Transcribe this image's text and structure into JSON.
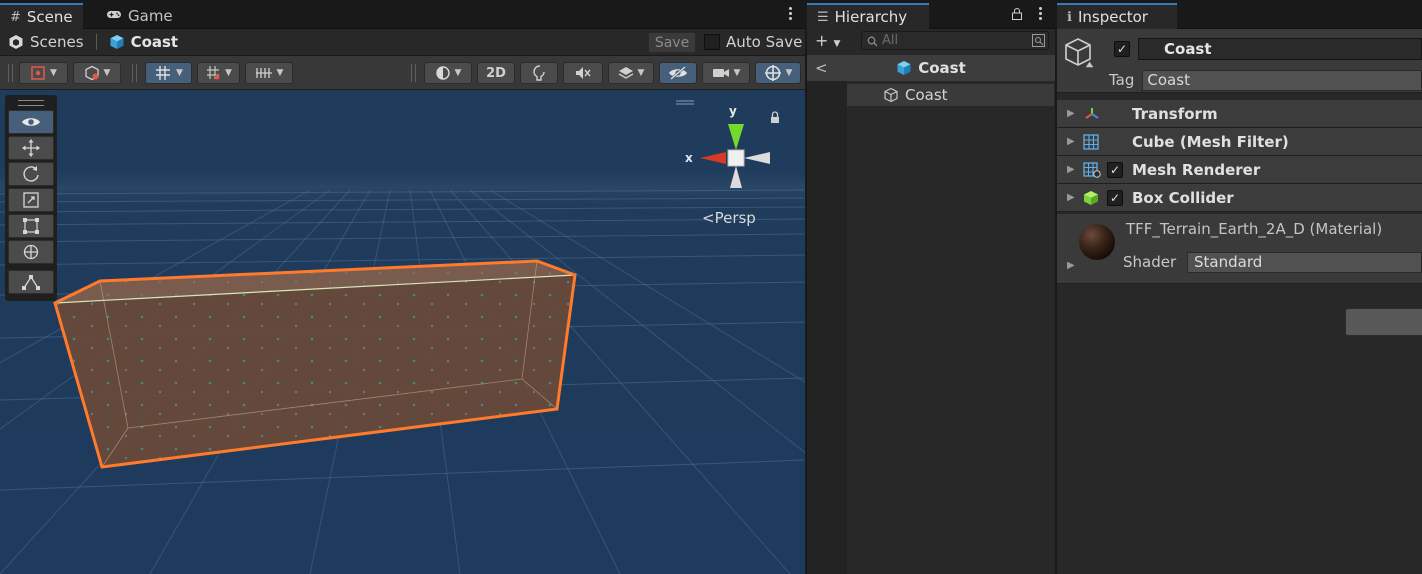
{
  "scene_panel": {
    "tabs": [
      {
        "label": "Scene",
        "icon": "hash-icon"
      },
      {
        "label": "Game",
        "icon": "gamepad-icon"
      }
    ],
    "breadcrumb": {
      "root": "Scenes",
      "current": "Coast"
    },
    "save_label": "Save",
    "autosave_label": "Auto Save",
    "toolbar": {
      "mode_2d": "2D"
    },
    "gizmo": {
      "y_label": "y",
      "x_label": "x",
      "projection": "Persp"
    }
  },
  "hierarchy": {
    "tab_label": "Hierarchy",
    "search_placeholder": "All",
    "scene_root": "Coast",
    "items": [
      {
        "label": "Coast"
      }
    ]
  },
  "inspector": {
    "tab_label": "Inspector",
    "object_name": "Coast",
    "object_enabled": true,
    "tag_label": "Tag",
    "tag_value": "Coast",
    "components": [
      {
        "label": "Transform",
        "icon": "transform-icon",
        "has_toggle": false
      },
      {
        "label": "Cube (Mesh Filter)",
        "icon": "mesh-filter-icon",
        "has_toggle": false
      },
      {
        "label": "Mesh Renderer",
        "icon": "mesh-renderer-icon",
        "has_toggle": true,
        "enabled": true
      },
      {
        "label": "Box Collider",
        "icon": "box-collider-icon",
        "has_toggle": true,
        "enabled": true
      }
    ],
    "material": {
      "name": "TFF_Terrain_Earth_2A_D (Material)",
      "shader_label": "Shader",
      "shader_value": "Standard"
    }
  },
  "colors": {
    "accent": "#3a79bb",
    "selection_outline": "#ff7a2a",
    "viewport_bg": "#1e3a5f"
  }
}
